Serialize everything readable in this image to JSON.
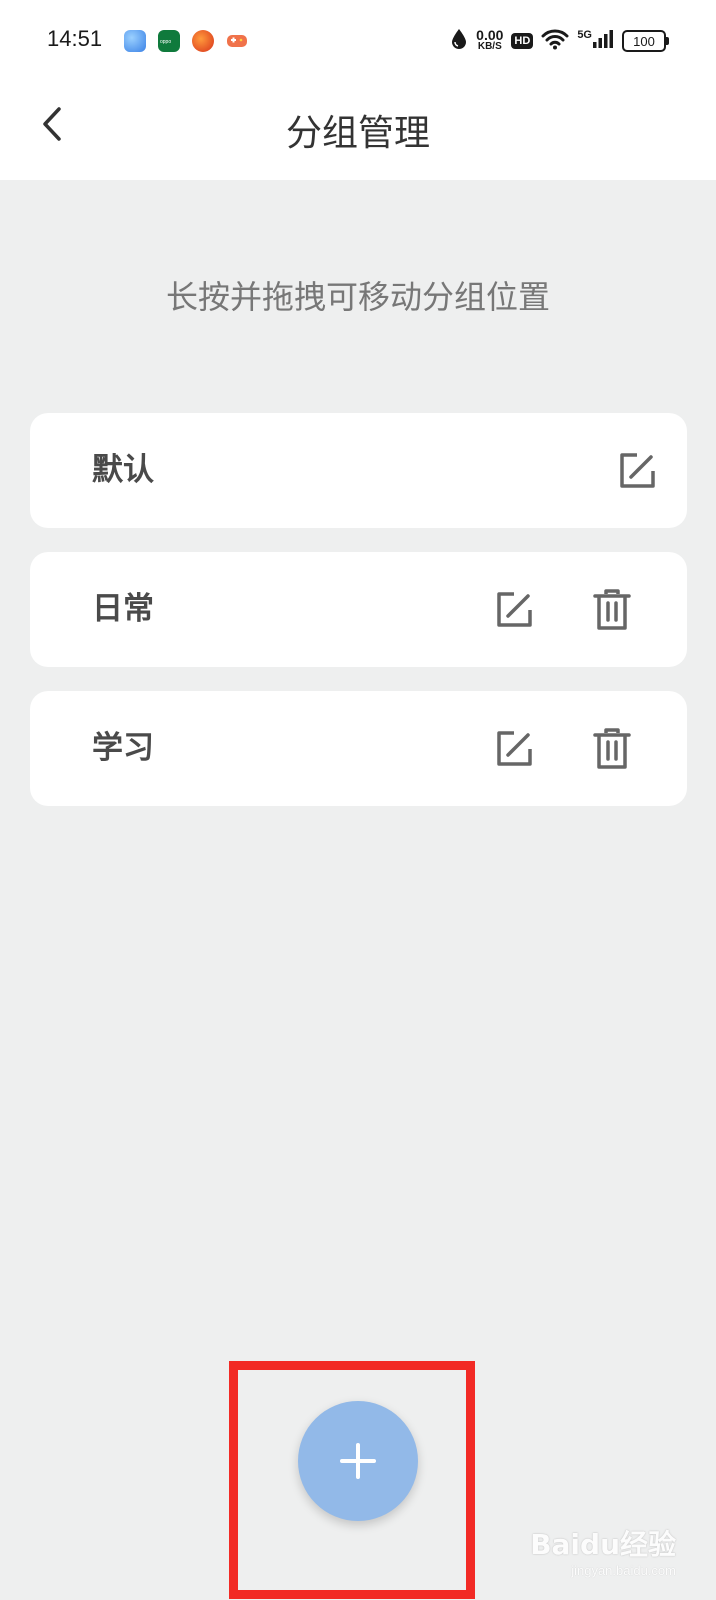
{
  "status_bar": {
    "time": "14:51",
    "app_icons": [
      {
        "name": "browser-app-icon",
        "color": "#4a9cf0"
      },
      {
        "name": "oppo-app-icon",
        "color": "#0f7a3c"
      },
      {
        "name": "orange-app-icon",
        "color": "#e0461c"
      },
      {
        "name": "game-app-icon",
        "color": "#f0724a"
      }
    ],
    "net_speed_value": "0.00",
    "net_speed_unit": "KB/S",
    "hd_label": "HD",
    "network_label": "5G",
    "battery_level": "100"
  },
  "header": {
    "title": "分组管理"
  },
  "hint": "长按并拖拽可移动分组位置",
  "groups": [
    {
      "name": "默认",
      "editable": true,
      "deletable": false
    },
    {
      "name": "日常",
      "editable": true,
      "deletable": true
    },
    {
      "name": "学习",
      "editable": true,
      "deletable": true
    }
  ],
  "fab": {
    "icon": "plus-icon",
    "color": "#92b9e8"
  },
  "highlight_color": "#f22a25",
  "watermark": {
    "main": "Baidu经验",
    "sub": "jingyan.baidu.com"
  }
}
